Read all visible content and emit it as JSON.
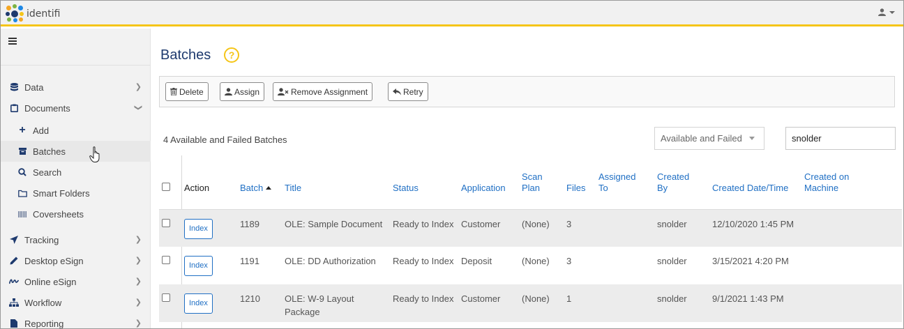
{
  "app": {
    "logo_text": "identifi"
  },
  "sidebar": {
    "items": [
      {
        "label": "Data",
        "icon": "database-icon"
      },
      {
        "label": "Documents",
        "icon": "clipboard-icon"
      },
      {
        "label": "Tracking",
        "icon": "paper-plane-icon"
      },
      {
        "label": "Desktop eSign",
        "icon": "pen-icon"
      },
      {
        "label": "Online eSign",
        "icon": "signature-icon"
      },
      {
        "label": "Workflow",
        "icon": "sitemap-icon"
      },
      {
        "label": "Reporting",
        "icon": "file-icon"
      }
    ],
    "documents_sub": [
      {
        "label": "Add",
        "icon": "plus-icon"
      },
      {
        "label": "Batches",
        "icon": "archive-icon"
      },
      {
        "label": "Search",
        "icon": "search-icon"
      },
      {
        "label": "Smart Folders",
        "icon": "folder-icon"
      },
      {
        "label": "Coversheets",
        "icon": "barcode-icon"
      }
    ]
  },
  "page": {
    "title": "Batches",
    "help": "?"
  },
  "toolbar": {
    "delete": "Delete",
    "assign": "Assign",
    "remove_assignment": "Remove Assignment",
    "retry": "Retry"
  },
  "list": {
    "count_text": "4 Available and Failed Batches",
    "filter_value": "Available and Failed",
    "search_value": "snolder"
  },
  "table": {
    "headers": {
      "action": "Action",
      "batch": "Batch",
      "title": "Title",
      "status": "Status",
      "application": "Application",
      "scan_plan": "Scan Plan",
      "files": "Files",
      "assigned_to": "Assigned To",
      "created_by": "Created By",
      "created_datetime": "Created Date/Time",
      "created_machine": "Created on Machine"
    },
    "rows": [
      {
        "action": "Index",
        "batch": "1189",
        "title": "OLE: Sample Document",
        "status": "Ready to Index",
        "application": "Customer",
        "scan_plan": "(None)",
        "files": "3",
        "assigned_to": "",
        "created_by": "snolder",
        "created_datetime": "12/10/2020 1:45 PM",
        "created_machine": ""
      },
      {
        "action": "Index",
        "batch": "1191",
        "title": "OLE: DD Authorization",
        "status": "Ready to Index",
        "application": "Deposit",
        "scan_plan": "(None)",
        "files": "3",
        "assigned_to": "",
        "created_by": "snolder",
        "created_datetime": "3/15/2021 4:20 PM",
        "created_machine": ""
      },
      {
        "action": "Index",
        "batch": "1210",
        "title": "OLE: W-9 Layout Package",
        "status": "Ready to Index",
        "application": "Customer",
        "scan_plan": "(None)",
        "files": "1",
        "assigned_to": "",
        "created_by": "snolder",
        "created_datetime": "9/1/2021 1:43 PM",
        "created_machine": ""
      }
    ]
  },
  "colors": {
    "brand_navy": "#1e3a6e",
    "accent_yellow": "#f5c518",
    "link_blue": "#1f6fc4"
  }
}
